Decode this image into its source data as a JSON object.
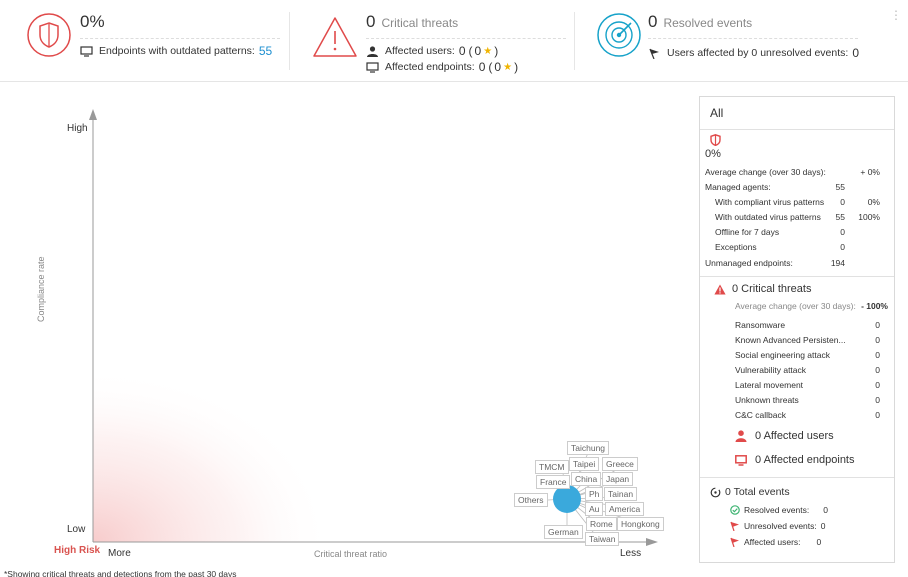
{
  "header": {
    "compliance": {
      "value": "0%",
      "endpoints_outdated_label": "Endpoints with outdated patterns:",
      "endpoints_outdated_count": "55"
    },
    "critical": {
      "count": "0",
      "label": "Critical threats",
      "affected_users_label": "Affected users:",
      "affected_users_value": "0",
      "affected_users_paren_open": "(",
      "affected_users_sub": "0",
      "affected_users_paren_close": ")",
      "affected_endpoints_label": "Affected endpoints:",
      "affected_endpoints_value": "0",
      "affected_endpoints_paren_open": "(",
      "affected_endpoints_sub": "0",
      "affected_endpoints_paren_close": ")",
      "star": "★"
    },
    "resolved": {
      "count": "0",
      "label": "Resolved events",
      "users_unresolved_label": "Users affected by 0 unresolved events:",
      "users_unresolved_value": "0"
    },
    "more_menu": "⋮"
  },
  "chart": {
    "y_high": "High",
    "y_low": "Low",
    "y_title": "Compliance rate",
    "x_more": "More",
    "x_less": "Less",
    "x_title": "Critical threat ratio",
    "risk_label": "High Risk",
    "bubble_color": "#3aa9dc",
    "tags": [
      "Taichung",
      "Taipei",
      "Greece",
      "TMCM",
      "China",
      "Japan",
      "France",
      "Ph",
      "Tainan",
      "Others",
      "Au",
      "America",
      "Rome",
      "Hongkong",
      "German",
      "Taiwan"
    ],
    "footnote": "*Showing critical threats and detections from the past 30 days"
  },
  "panel": {
    "title": "All",
    "compliance": {
      "value": "0%",
      "avg_change_label": "Average change (over 30 days):",
      "avg_change_value": "+ 0%",
      "managed_agents_label": "Managed agents:",
      "managed_agents_value": "55",
      "compliant_label": "With compliant virus patterns",
      "compliant_count": "0",
      "compliant_pct": "0%",
      "outdated_label": "With outdated virus patterns",
      "outdated_count": "55",
      "outdated_pct": "100%",
      "offline_label": "Offline for 7 days",
      "offline_count": "0",
      "exceptions_label": "Exceptions",
      "exceptions_count": "0",
      "unmanaged_label": "Unmanaged endpoints:",
      "unmanaged_value": "194"
    },
    "critical": {
      "title": "0 Critical threats",
      "avg_change_label": "Average change (over 30 days):",
      "avg_change_value": "- 100%",
      "threats": [
        {
          "name": "Ransomware",
          "value": "0"
        },
        {
          "name": "Known Advanced Persisten...",
          "value": "0"
        },
        {
          "name": "Social engineering attack",
          "value": "0"
        },
        {
          "name": "Vulnerability attack",
          "value": "0"
        },
        {
          "name": "Lateral movement",
          "value": "0"
        },
        {
          "name": "Unknown threats",
          "value": "0"
        },
        {
          "name": "C&C callback",
          "value": "0"
        }
      ],
      "affected_users": "0 Affected users",
      "affected_endpoints": "0 Affected endpoints"
    },
    "events": {
      "title": "0 Total events",
      "resolved_label": "Resolved events:",
      "resolved_value": "0",
      "unresolved_label": "Unresolved events:",
      "unresolved_value": "0",
      "affected_users_label": "Affected users:",
      "affected_users_value": "0"
    }
  },
  "colors": {
    "danger": "#e04a4a",
    "accent": "#1e8fd0",
    "teal": "#16a2c9",
    "success": "#3cb371"
  }
}
